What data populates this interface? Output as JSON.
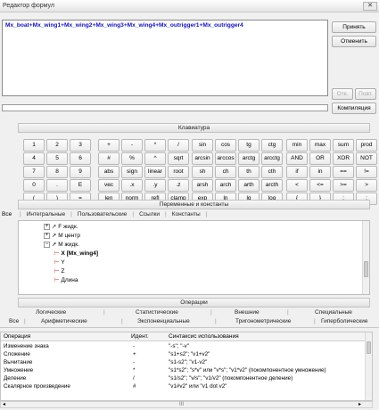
{
  "window": {
    "title": "Редактор формул",
    "close_label": "✕"
  },
  "editor": {
    "formula": "Mx_boat+Mx_wing1+Mx_wing2+Mx_wing3+Mx_wing4+Mx_outrigger1+Mx_outrigger4"
  },
  "buttons": {
    "accept": "Принять",
    "cancel": "Отменить",
    "cut": "Отк.",
    "repeat": "Повт.",
    "compile": "Компиляция"
  },
  "keyboard": {
    "title": "Клавиатура",
    "row1": [
      "1",
      "2",
      "3",
      "+",
      "-",
      "*",
      "/",
      "sin",
      "cos",
      "tg",
      "ctg",
      "min",
      "max",
      "sum",
      "prod"
    ],
    "row2": [
      "4",
      "5",
      "6",
      "#",
      "%",
      "^",
      "sqrt",
      "arcsin",
      "arccos",
      "arctg",
      "arcctg",
      "AND",
      "OR",
      "XOR",
      "NOT"
    ],
    "row3": [
      "7",
      "8",
      "9",
      "abs",
      "sign",
      "linear",
      "root",
      "sh",
      "ch",
      "th",
      "cth",
      "if",
      "in",
      "==",
      "!="
    ],
    "row4": [
      "0",
      ".",
      "E",
      "vec",
      ".x",
      ".y",
      ".z",
      "arsh",
      "arch",
      "arth",
      "arcth",
      "<",
      "<=",
      ">=",
      ">"
    ],
    "row5": [
      "(",
      ")",
      "=",
      "len",
      "norm",
      "refl",
      "clamp",
      "exp",
      "ln",
      "lg",
      "log",
      "{",
      "}",
      ":",
      ";"
    ]
  },
  "variables": {
    "title": "Переменные и константы",
    "left_label": "Все",
    "tabs": [
      "Интегральные",
      "Пользовательские",
      "Ссылки",
      "Константы"
    ],
    "tree": [
      {
        "label": "F жидк."
      },
      {
        "label": "M центр"
      },
      {
        "label": "M жидк."
      },
      {
        "label": "X  [Mx_wing4]"
      },
      {
        "label": "Y"
      },
      {
        "label": "Z"
      },
      {
        "label": "Длина"
      }
    ]
  },
  "operations": {
    "title": "Операции",
    "tabs_row1": [
      "Логические",
      "Статистические",
      "Внешние",
      "Специальные"
    ],
    "tabs_row2": [
      "Все",
      "Арифметические",
      "Экспоненциальные",
      "Тригонометрические",
      "Гиперболические"
    ],
    "columns": [
      "Операция",
      "Идент.",
      "Синтаксис использования"
    ],
    "rows": [
      [
        "Изменение знака",
        "-",
        "\"-s\"; \"-v\""
      ],
      [
        "Сложение",
        "+",
        "\"s1+s2\"; \"v1+v2\""
      ],
      [
        "Вычитание",
        "-",
        "\"s1-s2\"; \"v1-v2\""
      ],
      [
        "Умножение",
        "*",
        "\"s1*s2\"; \"s*v\" или \"v*s\"; \"v1*v2\" (покомпонентное умножение)"
      ],
      [
        "Деление",
        "/",
        "\"s1/s2\"; \"v/s\"; \"v1/v2\" (покомпонентное деление)"
      ],
      [
        "Скалярное произведение",
        "#",
        "\"v1#v2\" или \"v1 dot v2\""
      ]
    ],
    "scroll_marker": "III"
  }
}
